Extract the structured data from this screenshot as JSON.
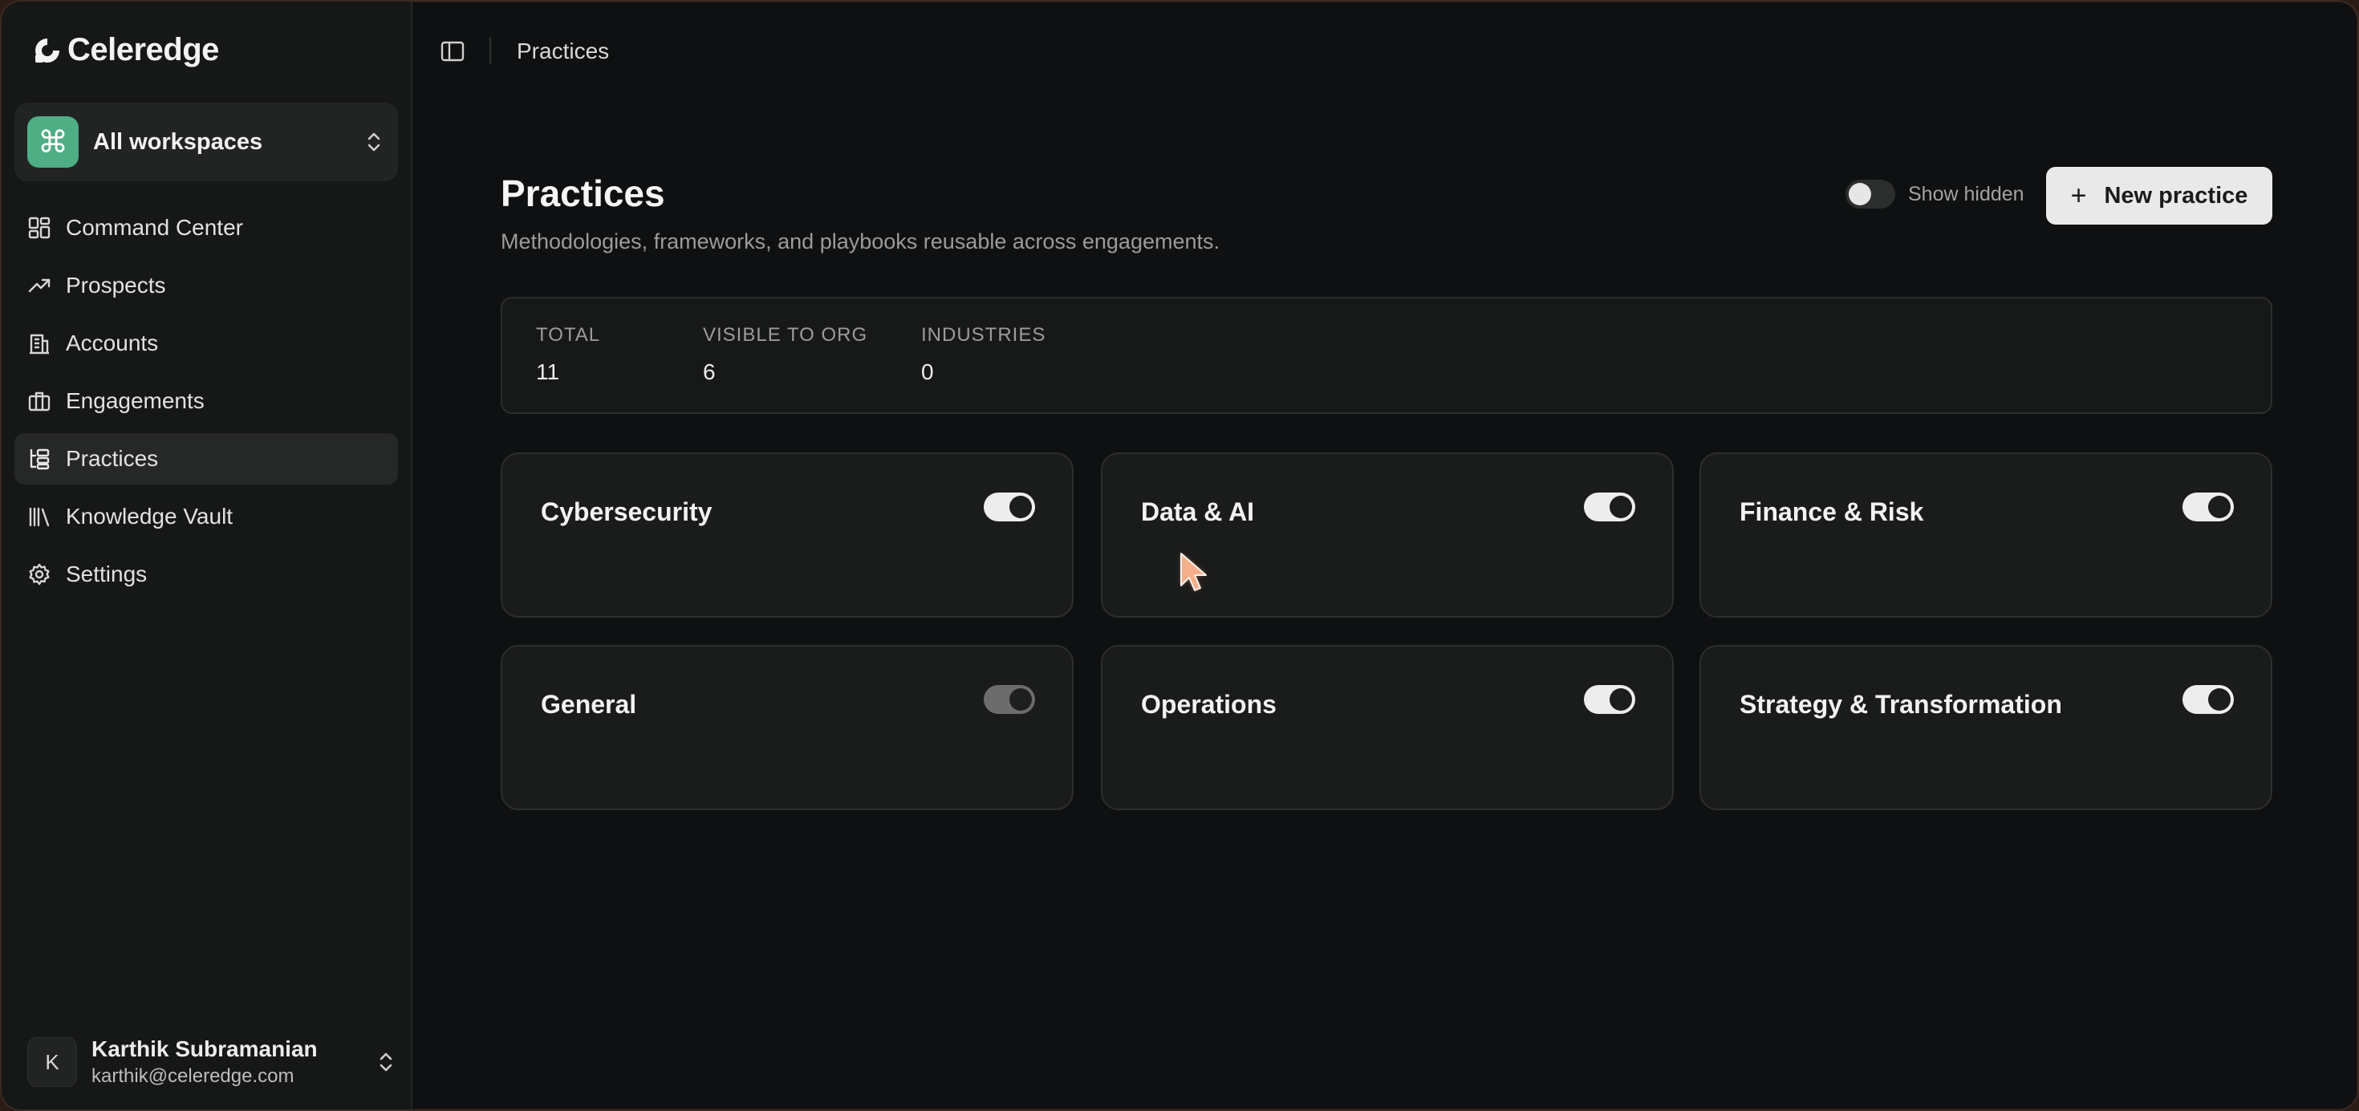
{
  "app": {
    "brand": "Celeredge"
  },
  "workspace": {
    "label": "All workspaces",
    "icon": "command-icon"
  },
  "nav": [
    {
      "label": "Command Center",
      "icon": "dashboard-icon",
      "active": false
    },
    {
      "label": "Prospects",
      "icon": "trending-up-icon",
      "active": false
    },
    {
      "label": "Accounts",
      "icon": "building-icon",
      "active": false
    },
    {
      "label": "Engagements",
      "icon": "briefcase-icon",
      "active": false
    },
    {
      "label": "Practices",
      "icon": "hierarchy-icon",
      "active": true
    },
    {
      "label": "Knowledge Vault",
      "icon": "library-icon",
      "active": false
    },
    {
      "label": "Settings",
      "icon": "gear-icon",
      "active": false
    }
  ],
  "user": {
    "initial": "K",
    "name": "Karthik Subramanian",
    "email": "karthik@celeredge.com"
  },
  "topbar": {
    "breadcrumb": "Practices"
  },
  "page": {
    "title": "Practices",
    "subtitle": "Methodologies, frameworks, and playbooks reusable across engagements.",
    "show_hidden_label": "Show hidden",
    "show_hidden_on": false,
    "new_button_label": "New practice"
  },
  "stats": [
    {
      "key": "TOTAL",
      "value": "11"
    },
    {
      "key": "VISIBLE TO ORG",
      "value": "6"
    },
    {
      "key": "INDUSTRIES",
      "value": "0"
    }
  ],
  "practices": [
    {
      "name": "Cybersecurity",
      "enabled": true
    },
    {
      "name": "Data & AI",
      "enabled": true
    },
    {
      "name": "Finance & Risk",
      "enabled": true
    },
    {
      "name": "General",
      "enabled": true,
      "muted": true
    },
    {
      "name": "Operations",
      "enabled": true
    },
    {
      "name": "Strategy & Transformation",
      "enabled": true
    }
  ],
  "colors": {
    "accent": "#4fae84",
    "background": "#0f1011",
    "button": "#e9e9e9"
  }
}
